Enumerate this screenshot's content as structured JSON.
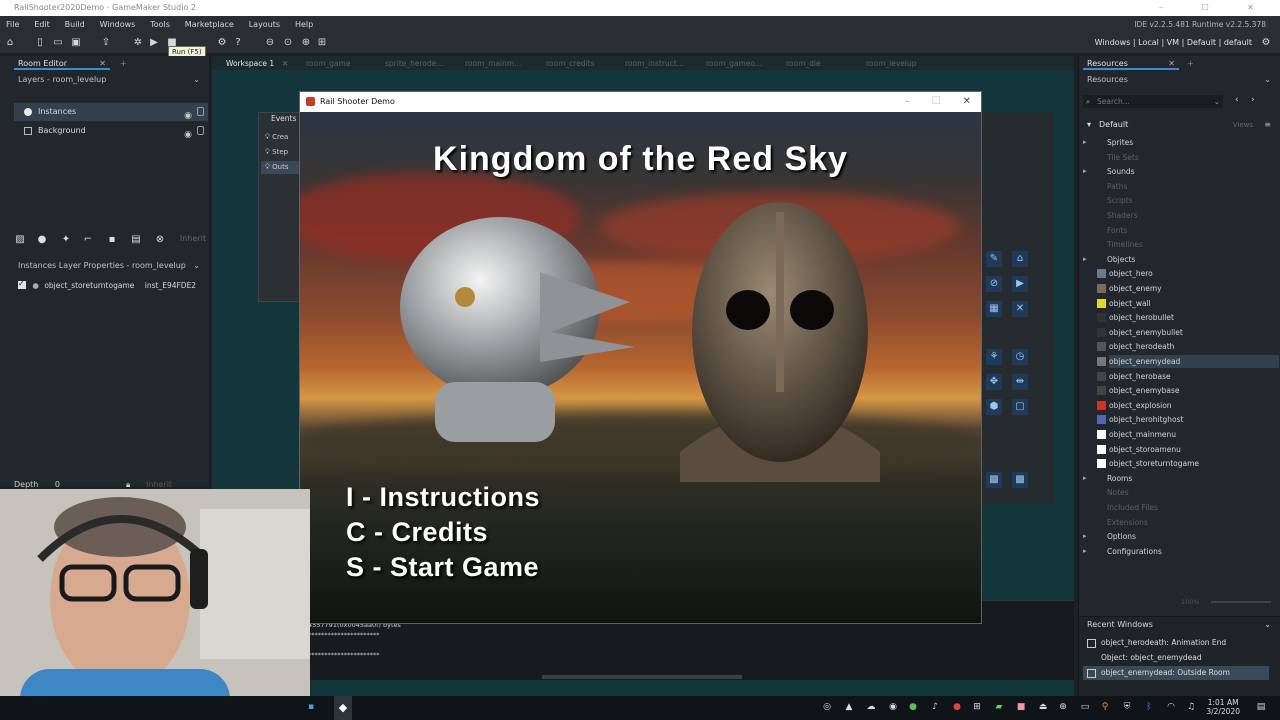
{
  "window": {
    "title": "RailShooter2020Demo - GameMaker Studio 2"
  },
  "menubar": {
    "items": [
      "File",
      "Edit",
      "Build",
      "Windows",
      "Tools",
      "Marketplace",
      "Layouts",
      "Help"
    ],
    "ide_version": "IDE v2.2.5.481  Runtime v2.2.5.378"
  },
  "toolbar": {
    "tooltip": "Run (F5)",
    "right_menu": "Windows | Local | VM | Default | default"
  },
  "room_editor": {
    "tab_label": "Room Editor",
    "layers_header": "Layers - room_levelup",
    "layers": [
      {
        "name": "Instances",
        "selected": true
      },
      {
        "name": "Background",
        "selected": false
      }
    ],
    "inherit_label": "Inherit",
    "props_header": "Instances Layer Properties - room_levelup",
    "instance_row": {
      "object": "object_storeturntogame",
      "id": "inst_E94FDE2"
    },
    "depth_label": "Depth",
    "depth_value": "0",
    "depth_inherit": "Inherit"
  },
  "workspace": {
    "tabs": [
      "Workspace 1",
      "room_game",
      "sprite_herode...",
      "room_mainm...",
      "room_credits",
      "room_instruct...",
      "room_gameo...",
      "room_die",
      "room_levelup"
    ],
    "events_label": "Events",
    "events": [
      "Crea",
      "Step",
      "Outs"
    ],
    "output_lines": [
      "4557791(0x0045aa0f) bytes",
      "**********************",
      "",
      "**********************"
    ]
  },
  "game_window": {
    "title": "Rail Shooter Demo",
    "heading": "Kingdom of the Red Sky",
    "menu": [
      "I - Instructions",
      "C - Credits",
      "S - Start Game"
    ]
  },
  "resources": {
    "tab_label": "Resources",
    "header": "Resources",
    "search_placeholder": "Search...",
    "group": "Default",
    "views_label": "Views",
    "tree": [
      {
        "label": "Sprites",
        "dim": false,
        "arrow": true
      },
      {
        "label": "Tile Sets",
        "dim": true,
        "arrow": false
      },
      {
        "label": "Sounds",
        "dim": false,
        "arrow": true
      },
      {
        "label": "Paths",
        "dim": true,
        "arrow": false
      },
      {
        "label": "Scripts",
        "dim": true,
        "arrow": false
      },
      {
        "label": "Shaders",
        "dim": true,
        "arrow": false
      },
      {
        "label": "Fonts",
        "dim": true,
        "arrow": false
      },
      {
        "label": "Timelines",
        "dim": true,
        "arrow": false
      },
      {
        "label": "Objects",
        "dim": false,
        "arrow": true
      }
    ],
    "objects": [
      "object_hero",
      "object_enemy",
      "object_wall",
      "object_herobullet",
      "object_enemybullet",
      "object_herodeath",
      "object_enemydead",
      "object_herobase",
      "object_enemybase",
      "object_explosion",
      "object_herohitghost",
      "object_mainmenu",
      "object_storoamenu",
      "object_storeturntogame"
    ],
    "selected_object": "object_enemydead",
    "tree_after": [
      {
        "label": "Rooms",
        "dim": false,
        "arrow": true
      },
      {
        "label": "Notes",
        "dim": true,
        "arrow": false
      },
      {
        "label": "Included Files",
        "dim": true,
        "arrow": false
      },
      {
        "label": "Extensions",
        "dim": true,
        "arrow": false
      },
      {
        "label": "Options",
        "dim": false,
        "arrow": true
      },
      {
        "label": "Configurations",
        "dim": false,
        "arrow": true
      }
    ],
    "zoom": "100%"
  },
  "recent_windows": {
    "header": "Recent Windows",
    "items": [
      "object_herodeath: Animation End",
      "Object: object_enemydead",
      "object_enemydead: Outside Room"
    ]
  },
  "taskbar": {
    "time": "1:01 AM",
    "date": "3/2/2020"
  },
  "colors": {
    "accent": "#3d8ccf",
    "panel": "#22272d",
    "workspace": "#12363a"
  }
}
